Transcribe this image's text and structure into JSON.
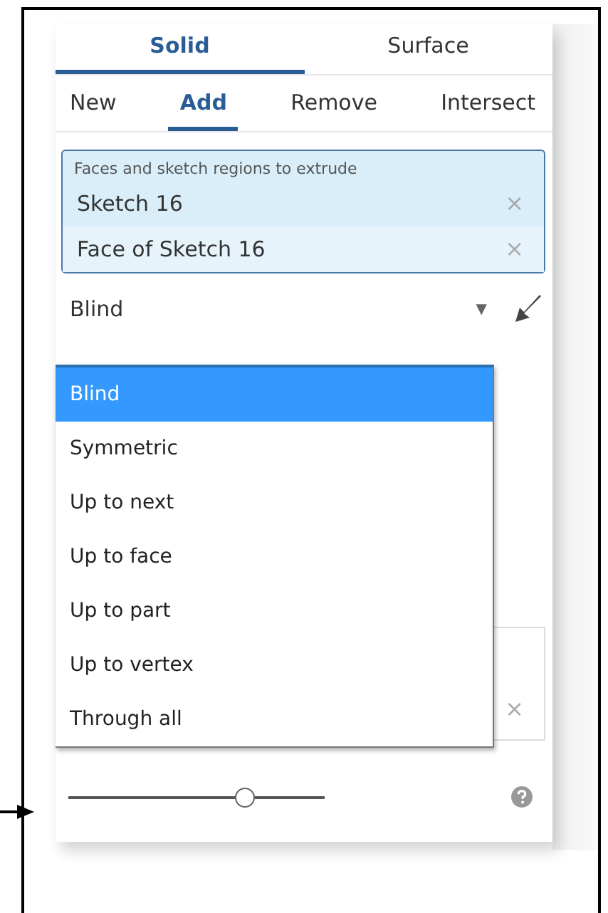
{
  "body_tabs": [
    {
      "label": "Solid",
      "selected": true
    },
    {
      "label": "Surface",
      "selected": false
    }
  ],
  "operation_tabs": [
    {
      "label": "New",
      "selected": false
    },
    {
      "label": "Add",
      "selected": true
    },
    {
      "label": "Remove",
      "selected": false
    },
    {
      "label": "Intersect",
      "selected": false
    }
  ],
  "selection": {
    "label": "Faces and sketch regions to extrude",
    "items": [
      "Sketch 16",
      "Face of Sketch 16"
    ],
    "remove_glyph": "×"
  },
  "end_type": {
    "value": "Blind",
    "caret": "▼",
    "expanded": true,
    "options": [
      {
        "label": "Blind",
        "selected": true
      },
      {
        "label": "Symmetric",
        "selected": false
      },
      {
        "label": "Up to next",
        "selected": false
      },
      {
        "label": "Up to face",
        "selected": false
      },
      {
        "label": "Up to part",
        "selected": false
      },
      {
        "label": "Up to vertex",
        "selected": false
      },
      {
        "label": "Through all",
        "selected": false
      }
    ]
  },
  "hidden_field": {
    "remove_glyph": "×"
  },
  "slider": {
    "level": 0.69
  }
}
